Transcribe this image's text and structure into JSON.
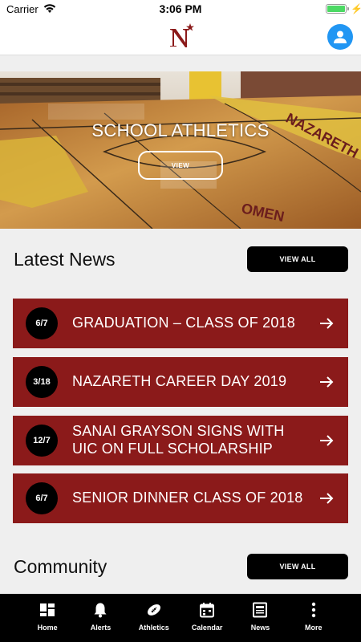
{
  "status_bar": {
    "carrier": "Carrier",
    "time": "3:06 PM"
  },
  "hero": {
    "title": "SCHOOL ATHLETICS",
    "button": "VIEW",
    "floor_text_1": "NAZARETH",
    "floor_text_2": "OMEN"
  },
  "latest_news": {
    "title": "Latest News",
    "view_all": "VIEW ALL",
    "items": [
      {
        "date": "6/7",
        "title": "GRADUATION – CLASS OF 2018"
      },
      {
        "date": "3/18",
        "title": "NAZARETH CAREER DAY 2019"
      },
      {
        "date": "12/7",
        "title": "SANAI GRAYSON SIGNS WITH UIC ON FULL SCHOLARSHIP"
      },
      {
        "date": "6/7",
        "title": "SENIOR DINNER CLASS OF 2018"
      }
    ]
  },
  "community": {
    "title": "Community",
    "view_all": "VIEW ALL"
  },
  "tab_bar": {
    "items": [
      {
        "label": "Home",
        "icon": "home-grid-icon"
      },
      {
        "label": "Alerts",
        "icon": "bell-icon"
      },
      {
        "label": "Athletics",
        "icon": "football-icon"
      },
      {
        "label": "Calendar",
        "icon": "calendar-icon"
      },
      {
        "label": "News",
        "icon": "newspaper-icon"
      },
      {
        "label": "More",
        "icon": "more-vertical-icon"
      }
    ]
  },
  "colors": {
    "card": "#8b1a1a",
    "accent": "#2196f3",
    "logo": "#8b1a1a"
  }
}
